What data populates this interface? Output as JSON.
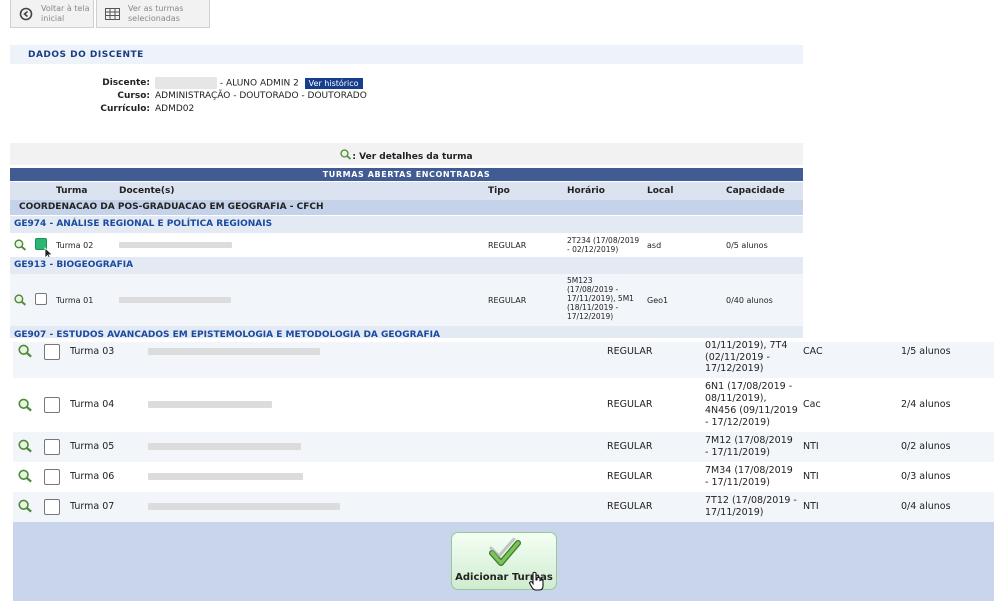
{
  "toolbar": {
    "back_label": "Voltar à tela inicial",
    "back_line1": "Voltar à tela",
    "back_line2": "inicial",
    "view_line1": "Ver as turmas",
    "view_line2": "selecionadas"
  },
  "dados": {
    "title": "Dados do Discente",
    "discente_label": "Discente:",
    "discente_value": "- ALUNO ADMIN 2",
    "historico_button": "Ver histórico",
    "curso_label": "Curso:",
    "curso_value": "ADMINISTRAÇÃO - DOUTORADO - DOUTORADO",
    "curriculo_label": "Currículo:",
    "curriculo_value": "ADMD02"
  },
  "legend": {
    "text": ": Ver detalhes da turma"
  },
  "table": {
    "title": "Turmas Abertas Encontradas",
    "headers": {
      "turma": "Turma",
      "docente": "Docente(s)",
      "tipo": "Tipo",
      "horario": "Horário",
      "local": "Local",
      "capacidade": "Capacidade"
    },
    "coordenacao": "COORDENACAO DA POS-GRADUACAO EM GEOGRAFIA - CFCH",
    "disciplinas": [
      "GE974 - ANÁLISE REGIONAL E POLÍTICA REGIONAIS",
      "GE913 - BIOGEOGRAFIA",
      "GE907 - ESTUDOS AVANCADOS EM EPISTEMOLOGIA E METODOLOGIA DA GEOGRAFIA"
    ],
    "rows_top": [
      {
        "turma": "Turma 02",
        "tipo": "REGULAR",
        "horario1": "2T234 (17/08/2019",
        "horario2": "- 02/12/2019)",
        "local": "asd",
        "capacidade": "0/5 alunos",
        "checked": true
      },
      {
        "turma": "Turma 01",
        "tipo": "REGULAR",
        "horario1": "5M123",
        "horario2": "(17/08/2019 -",
        "horario3": "17/11/2019), 5M1",
        "horario4": "(18/11/2019 -",
        "horario5": "17/12/2019)",
        "local": "Geo1",
        "capacidade": "0/40 alunos",
        "checked": false
      }
    ],
    "rows_bottom": [
      {
        "turma": "Turma 03",
        "tipo": "REGULAR",
        "h1": "01/11/2019), 7T4",
        "h2": "(02/11/2019 -",
        "h3": "17/12/2019)",
        "local": "CAC",
        "capacidade": "1/5 alunos"
      },
      {
        "turma": "Turma 04",
        "tipo": "REGULAR",
        "h1": "6N1 (17/08/2019 -",
        "h2": "08/11/2019),",
        "h3": "4N456 (09/11/2019",
        "h4": "- 17/12/2019)",
        "local": "Cac",
        "capacidade": "2/4 alunos"
      },
      {
        "turma": "Turma 05",
        "tipo": "REGULAR",
        "h1": "7M12 (17/08/2019",
        "h2": "- 17/11/2019)",
        "local": "NTI",
        "capacidade": "0/2 alunos"
      },
      {
        "turma": "Turma 06",
        "tipo": "REGULAR",
        "h1": "7M34 (17/08/2019",
        "h2": "- 17/11/2019)",
        "local": "NTI",
        "capacidade": "0/3 alunos"
      },
      {
        "turma": "Turma 07",
        "tipo": "REGULAR",
        "h1": "7T12 (17/08/2019 -",
        "h2": "17/11/2019)",
        "local": "NTI",
        "capacidade": "0/4 alunos"
      }
    ]
  },
  "actions": {
    "add_button": "Adicionar Turmas"
  },
  "colors": {
    "header_blue": "#405c93",
    "title_blue": "#1a3c86",
    "accent_green": "#2bb673"
  }
}
